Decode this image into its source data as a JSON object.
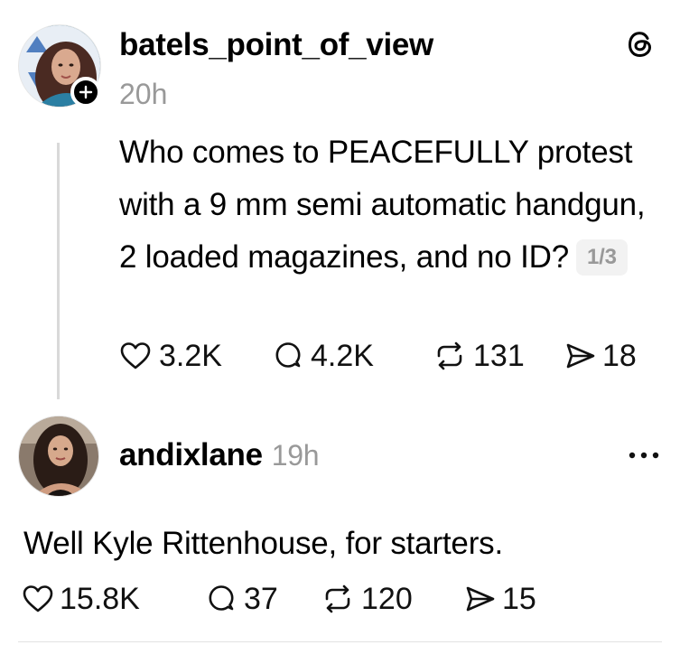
{
  "post": {
    "username": "batels_point_of_view",
    "time": "20h",
    "text": "Who comes to PEACEFULLY protest with a 9 mm semi automatic handgun, 2 loaded magazines, and no ID?",
    "thread_counter": "1/3",
    "stats": {
      "likes": "3.2K",
      "replies": "4.2K",
      "reposts": "131",
      "shares": "18"
    },
    "icons": {
      "avatar": "avatar",
      "follow": "plus-icon",
      "app": "threads-logo-icon",
      "like": "heart-icon",
      "reply": "comment-bubble-icon",
      "repost": "repost-icon",
      "share": "send-icon"
    }
  },
  "reply": {
    "username": "andixlane",
    "time": "19h",
    "text": "Well Kyle Rittenhouse, for starters.",
    "stats": {
      "likes": "15.8K",
      "replies": "37",
      "reposts": "120",
      "shares": "15"
    },
    "icons": {
      "avatar": "avatar",
      "more": "more-options-icon",
      "like": "heart-icon",
      "reply": "comment-bubble-icon",
      "repost": "repost-icon",
      "share": "send-icon"
    }
  },
  "colors": {
    "text": "#000000",
    "muted": "#999999",
    "thread_line": "#d9d9d9",
    "pill_bg": "#f2f2f2"
  }
}
